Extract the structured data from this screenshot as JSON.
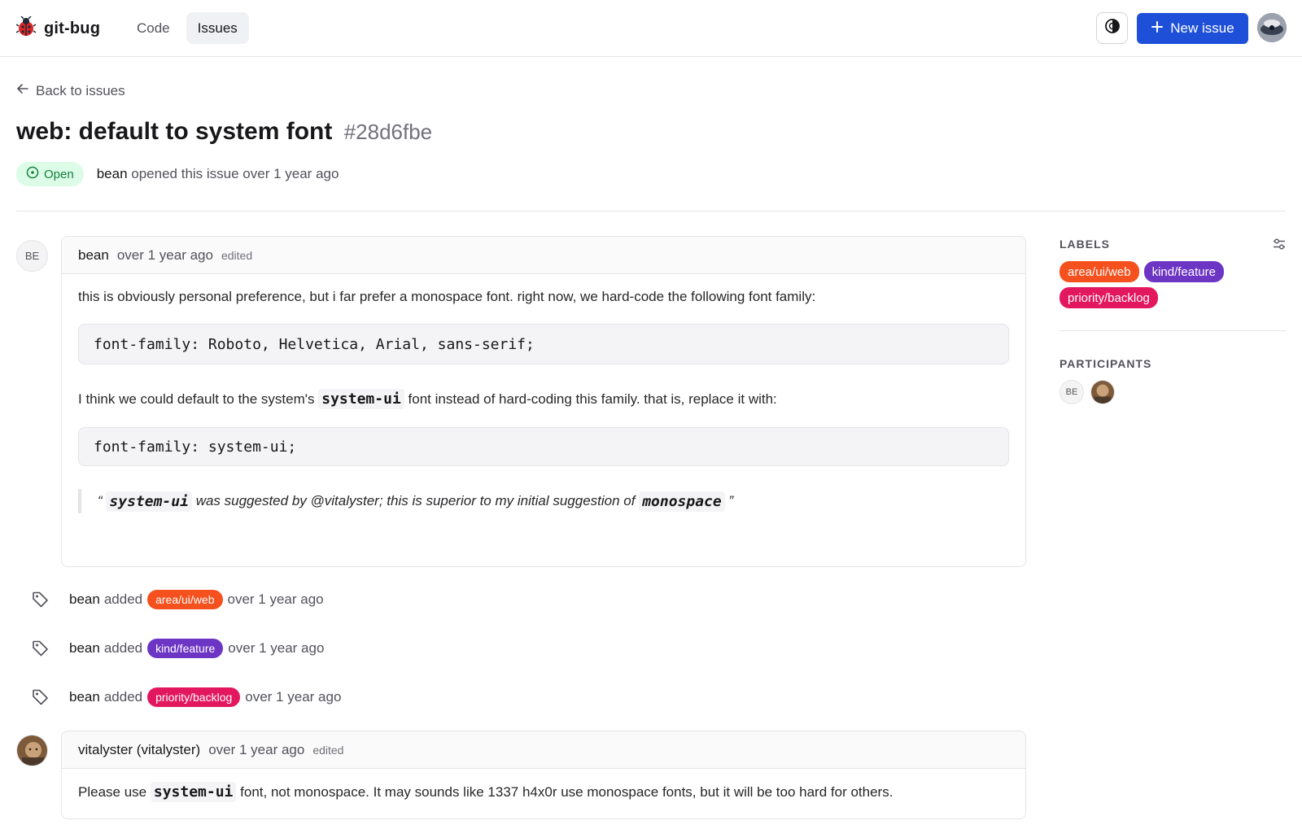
{
  "header": {
    "brand": "git-bug",
    "nav": [
      {
        "label": "Code",
        "active": false
      },
      {
        "label": "Issues",
        "active": true
      }
    ],
    "new_issue_label": "New issue",
    "accent": "#1d4fd8"
  },
  "issue": {
    "back_label": "Back to issues",
    "title": "web: default to system font",
    "id": "#28d6fbe",
    "status": "Open",
    "author": "bean",
    "opened_text": "opened this issue over 1 year ago"
  },
  "timeline": {
    "first_comment": {
      "avatar_initials": "BE",
      "author": "bean",
      "time": "over 1 year ago",
      "edited": "edited",
      "p1": "this is obviously personal preference, but i far prefer a monospace font. right now, we hard-code the following font family:",
      "code1": "font-family: Roboto, Helvetica, Arial, sans-serif;",
      "p2_before": "I think we could default to the system's",
      "p2_code": "system-ui",
      "p2_after": "font instead of hard-coding this family. that is, replace it with:",
      "code2": "font-family: system-ui;",
      "quote_open": "“",
      "quote_code1": "system-ui",
      "quote_mid": "was suggested by @vitalyster; this is superior to my initial suggestion of",
      "quote_code2": "monospace",
      "quote_close": "”"
    },
    "events": [
      {
        "author": "bean",
        "action": "added",
        "label": "area/ui/web",
        "time": "over 1 year ago"
      },
      {
        "author": "bean",
        "action": "added",
        "label": "kind/feature",
        "time": "over 1 year ago"
      },
      {
        "author": "bean",
        "action": "added",
        "label": "priority/backlog",
        "time": "over 1 year ago"
      }
    ],
    "second_comment": {
      "author": "vitalyster (vitalyster)",
      "time": "over 1 year ago",
      "edited": "edited",
      "body_before": "Please use",
      "body_code": "system-ui",
      "body_after": "font, not monospace. It may sounds like 1337 h4x0r use monospace fonts, but it will be too hard for others."
    }
  },
  "sidebar": {
    "labels_heading": "LABELS",
    "labels": [
      {
        "name": "area/ui/web",
        "color": "#f4511e"
      },
      {
        "name": "kind/feature",
        "color": "#6d35c4"
      },
      {
        "name": "priority/backlog",
        "color": "#e3175d"
      }
    ],
    "participants_heading": "PARTICIPANTS",
    "participants": [
      {
        "initials": "BE"
      },
      {
        "initials": ""
      }
    ]
  },
  "icons": [
    "bug-logo-icon",
    "theme-toggle-icon",
    "plus-icon",
    "arrow-left-icon",
    "open-circle-icon",
    "tag-icon",
    "settings-sliders-icon"
  ]
}
